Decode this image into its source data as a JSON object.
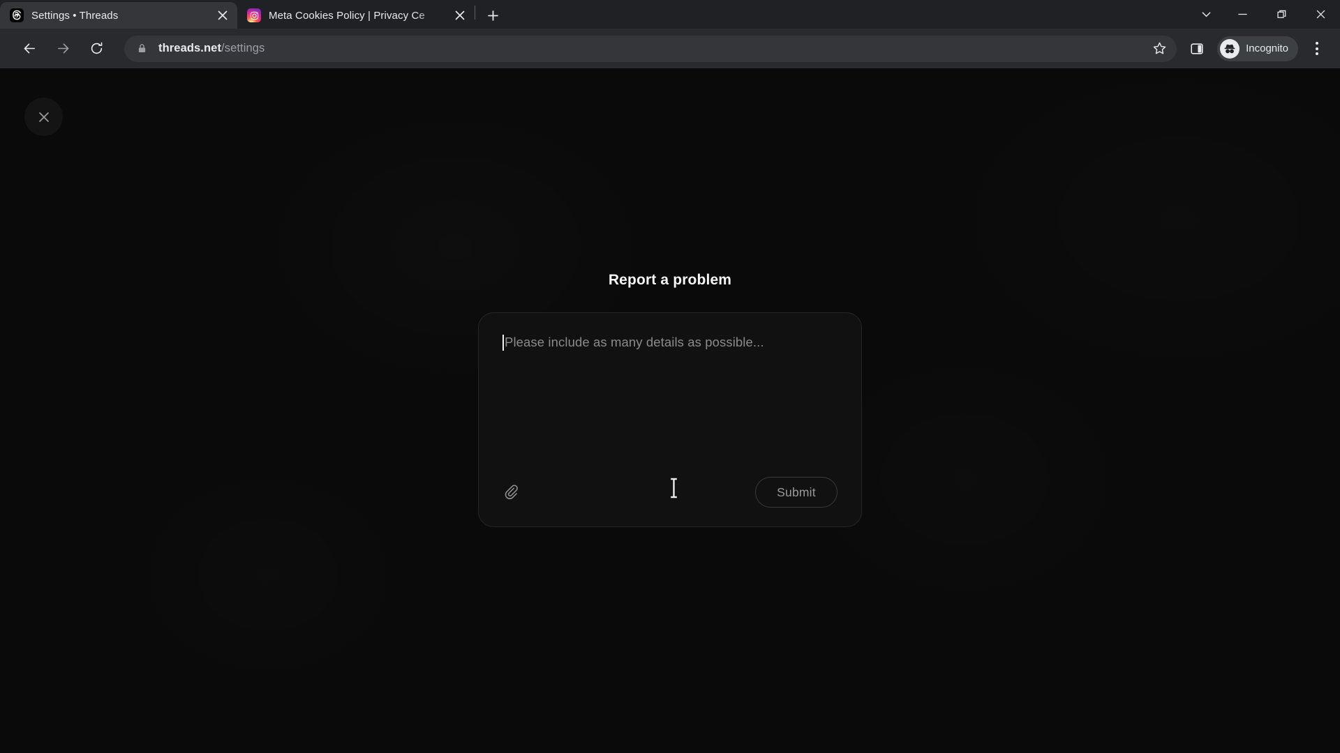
{
  "browser": {
    "tabs": [
      {
        "title": "Settings • Threads",
        "favicon": "threads-icon",
        "active": true,
        "close_label": "×"
      },
      {
        "title": "Meta Cookies Policy | Privacy Ce",
        "favicon": "instagram-icon",
        "active": false,
        "close_label": "×"
      }
    ],
    "new_tab_label": "+",
    "window_controls": {
      "tab_search": "tab-search-chevron-icon",
      "minimize": "minimize-icon",
      "maximize": "maximize-restore-icon",
      "close": "window-close-icon"
    },
    "toolbar": {
      "back": "back-arrow-icon",
      "forward": "forward-arrow-icon",
      "reload": "reload-icon",
      "lock": "lock-icon",
      "url_domain": "threads.net",
      "url_path": "/settings",
      "bookmark": "star-icon",
      "side_panel": "side-panel-icon",
      "profile_label": "Incognito",
      "profile_avatar": "incognito-spy-icon",
      "menu": "three-dot-menu-icon"
    }
  },
  "page": {
    "close_button": "close-x-icon",
    "heading": "Report a problem",
    "textarea": {
      "placeholder": "Please include as many details as possible...",
      "value": ""
    },
    "attach_icon": "paperclip-icon",
    "submit_label": "Submit"
  },
  "colors": {
    "page_bg": "#0a0a0a",
    "card_bg": "#111111",
    "card_border": "#262626",
    "tabstrip_bg": "#202124",
    "toolbar_bg": "#292a2d",
    "active_tab_bg": "#35363a",
    "omnibox_bg": "#35363a",
    "text_primary": "#e8eaed",
    "text_muted": "#9aa0a6",
    "placeholder": "#8b8b8b",
    "submit_text": "#9a9a9a"
  }
}
